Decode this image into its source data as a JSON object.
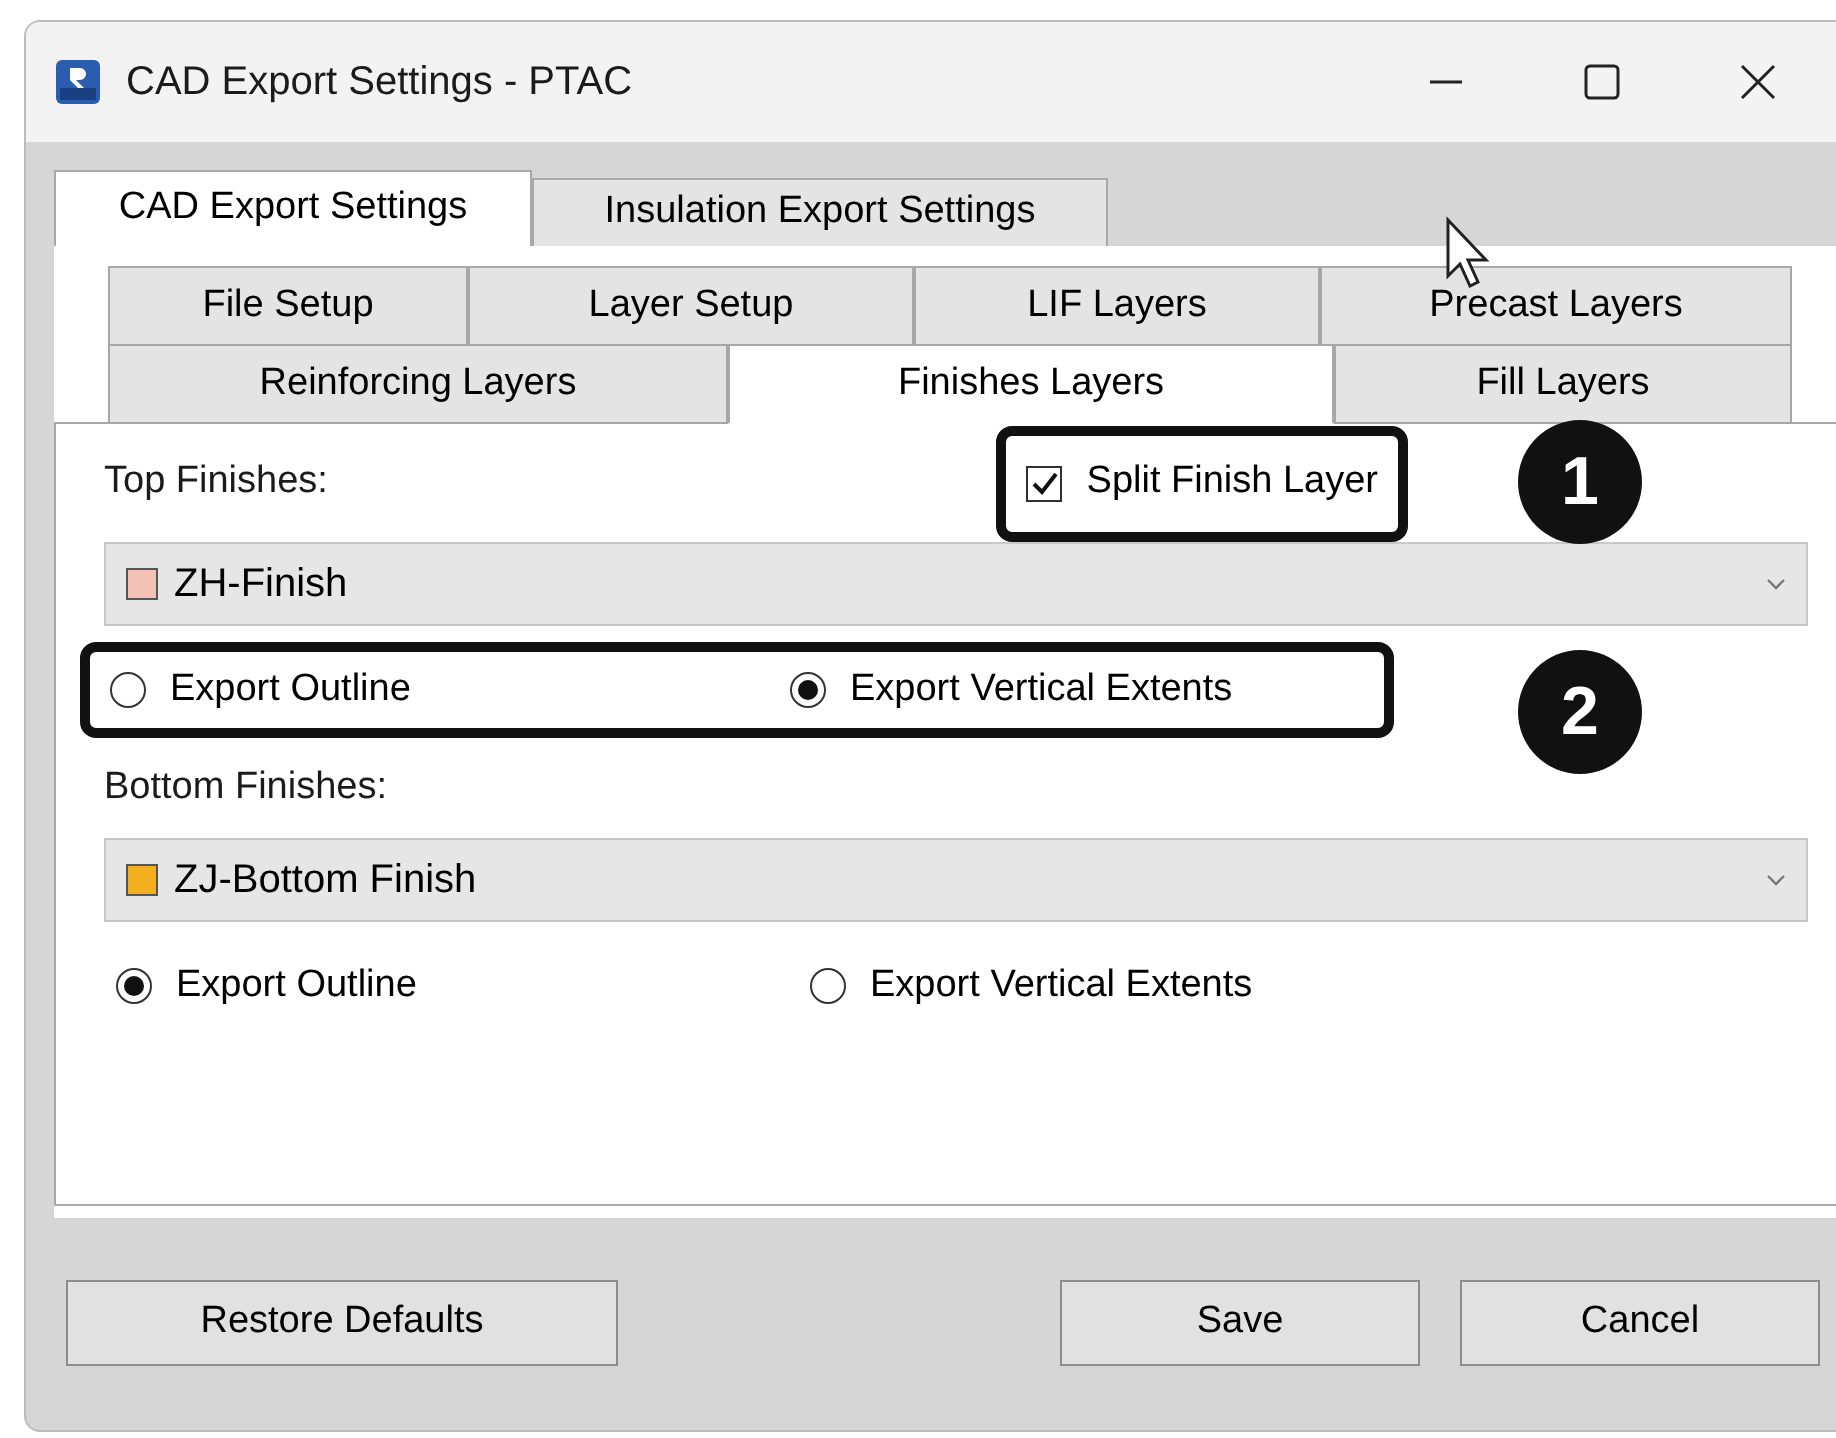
{
  "window": {
    "title": "CAD Export Settings - PTAC"
  },
  "outer_tabs": [
    {
      "label": "CAD Export Settings",
      "selected": true
    },
    {
      "label": "Insulation Export Settings",
      "selected": false
    }
  ],
  "tab_rows": [
    {
      "tabs": [
        {
          "label": "File Setup",
          "selected": false
        },
        {
          "label": "Layer Setup",
          "selected": false
        },
        {
          "label": "LIF Layers",
          "selected": false
        },
        {
          "label": "Precast Layers",
          "selected": false
        }
      ]
    },
    {
      "tabs": [
        {
          "label": "Reinforcing Layers",
          "selected": false
        },
        {
          "label": "Finishes Layers",
          "selected": true
        },
        {
          "label": "Fill Layers",
          "selected": false
        }
      ]
    }
  ],
  "sections": [
    {
      "label": "Top Finishes:",
      "split": {
        "label": "Split Finish Layer",
        "checked": true
      },
      "layer": {
        "name": "ZH-Finish",
        "color": "#f4c2b4"
      },
      "options": [
        {
          "label": "Export Outline",
          "selected": false
        },
        {
          "label": "Export Vertical Extents",
          "selected": true
        }
      ]
    },
    {
      "label": "Bottom Finishes:",
      "layer": {
        "name": "ZJ-Bottom Finish",
        "color": "#f2b01e"
      },
      "options": [
        {
          "label": "Export Outline",
          "selected": true
        },
        {
          "label": "Export Vertical Extents",
          "selected": false
        }
      ]
    }
  ],
  "callouts": [
    "1",
    "2"
  ],
  "buttons": [
    "Restore Defaults",
    "Save",
    "Cancel"
  ]
}
